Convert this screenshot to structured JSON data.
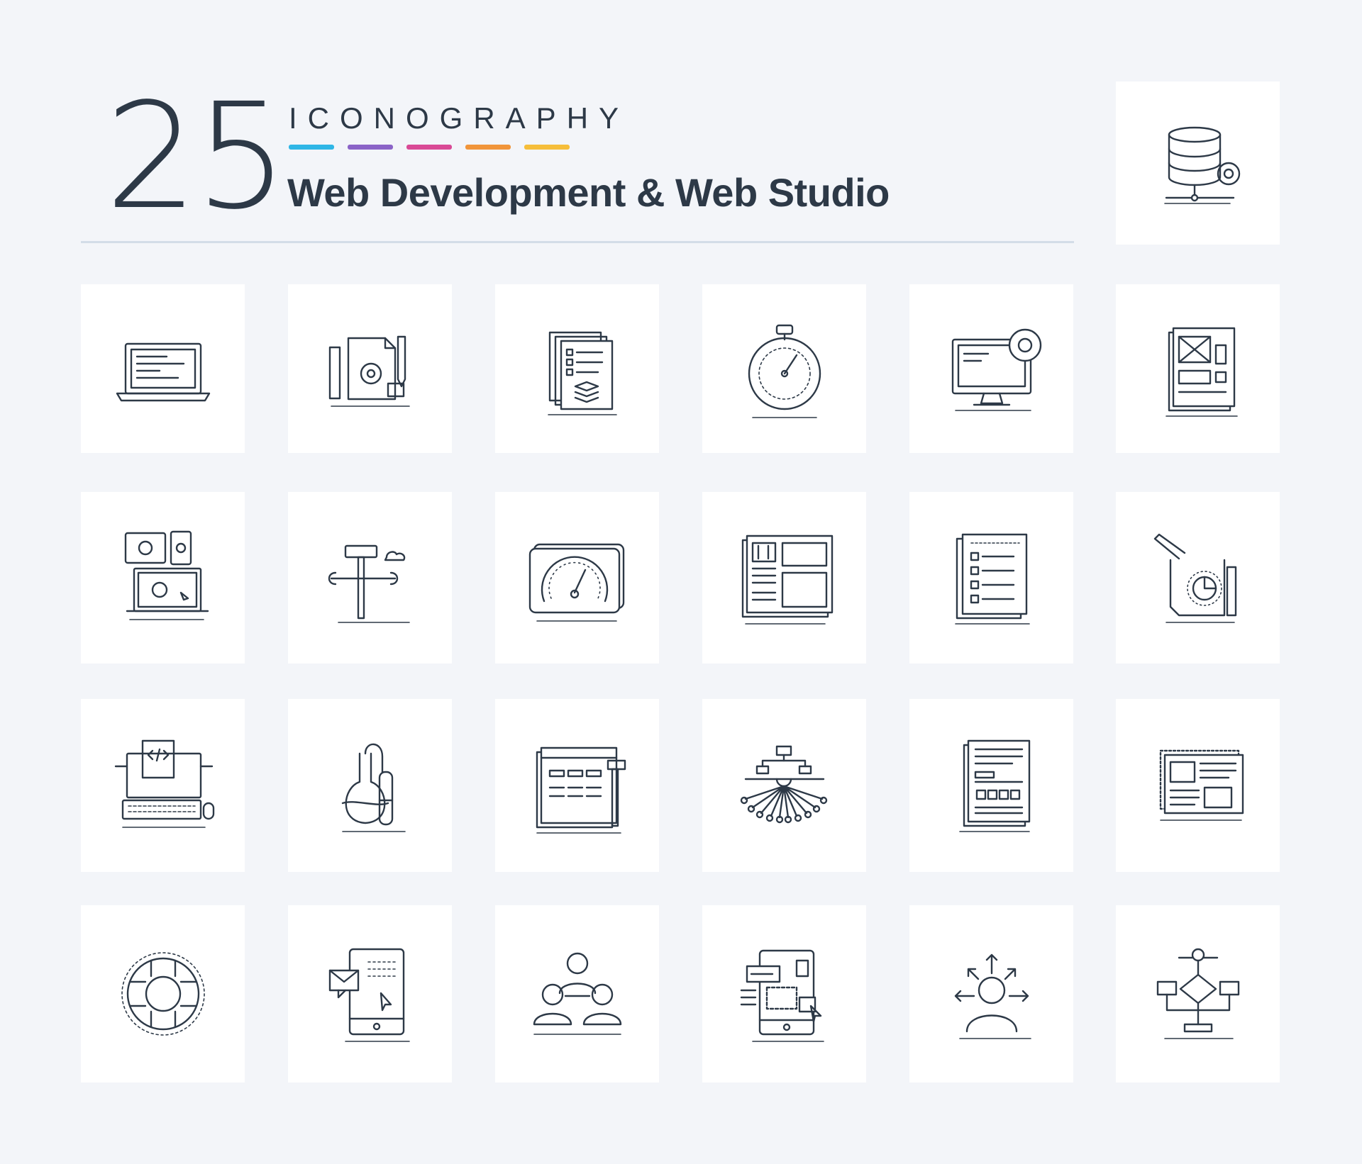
{
  "header": {
    "count": "25",
    "brand": "ICONOGRAPHY",
    "title": "Web Development & Web Studio",
    "accent_colors": [
      "#2fb6e6",
      "#8a63c7",
      "#d94a96",
      "#f1953a",
      "#f6be3a"
    ]
  },
  "icons": [
    "database-gear-icon",
    "laptop-code-icon",
    "design-document-icon",
    "file-layers-icon",
    "stopwatch-icon",
    "monitor-gear-icon",
    "wireframe-layout-icon",
    "responsive-devices-icon",
    "hammer-wrench-cloud-icon",
    "speedometer-icon",
    "page-layout-icon",
    "checklist-icon",
    "pencil-pie-chart-icon",
    "code-computer-icon",
    "flask-test-tube-icon",
    "browser-hammer-icon",
    "network-hierarchy-icon",
    "web-page-icon",
    "layout-template-icon",
    "lifebuoy-icon",
    "mobile-mail-icon",
    "team-icon",
    "mobile-ui-icon",
    "person-arrows-icon",
    "flowchart-icon"
  ]
}
